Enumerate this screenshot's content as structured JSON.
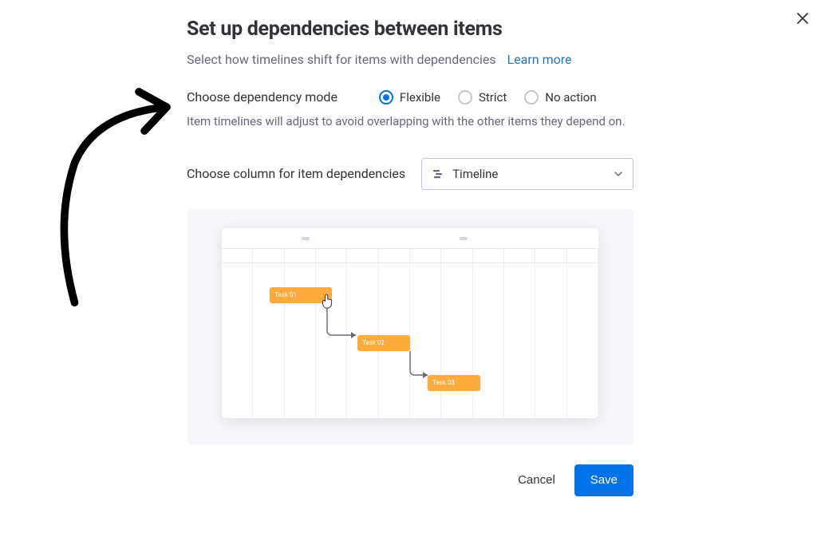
{
  "dialog": {
    "title": "Set up dependencies between items",
    "subtitle": "Select how timelines shift for items with dependencies",
    "learn_more": "Learn more",
    "mode_label": "Choose dependency mode",
    "mode_options": [
      {
        "label": "Flexible",
        "selected": true
      },
      {
        "label": "Strict",
        "selected": false
      },
      {
        "label": "No action",
        "selected": false
      }
    ],
    "mode_description": "Item timelines will adjust to avoid overlapping with the other items they depend on.",
    "column_label": "Choose column for item dependencies",
    "column_select": {
      "label": "Timeline"
    },
    "preview_tasks": [
      "Task 01",
      "Task 02",
      "Task 03"
    ],
    "cancel": "Cancel",
    "save": "Save"
  },
  "colors": {
    "accent": "#0073ea",
    "task_bar": "#FDAB3D"
  }
}
